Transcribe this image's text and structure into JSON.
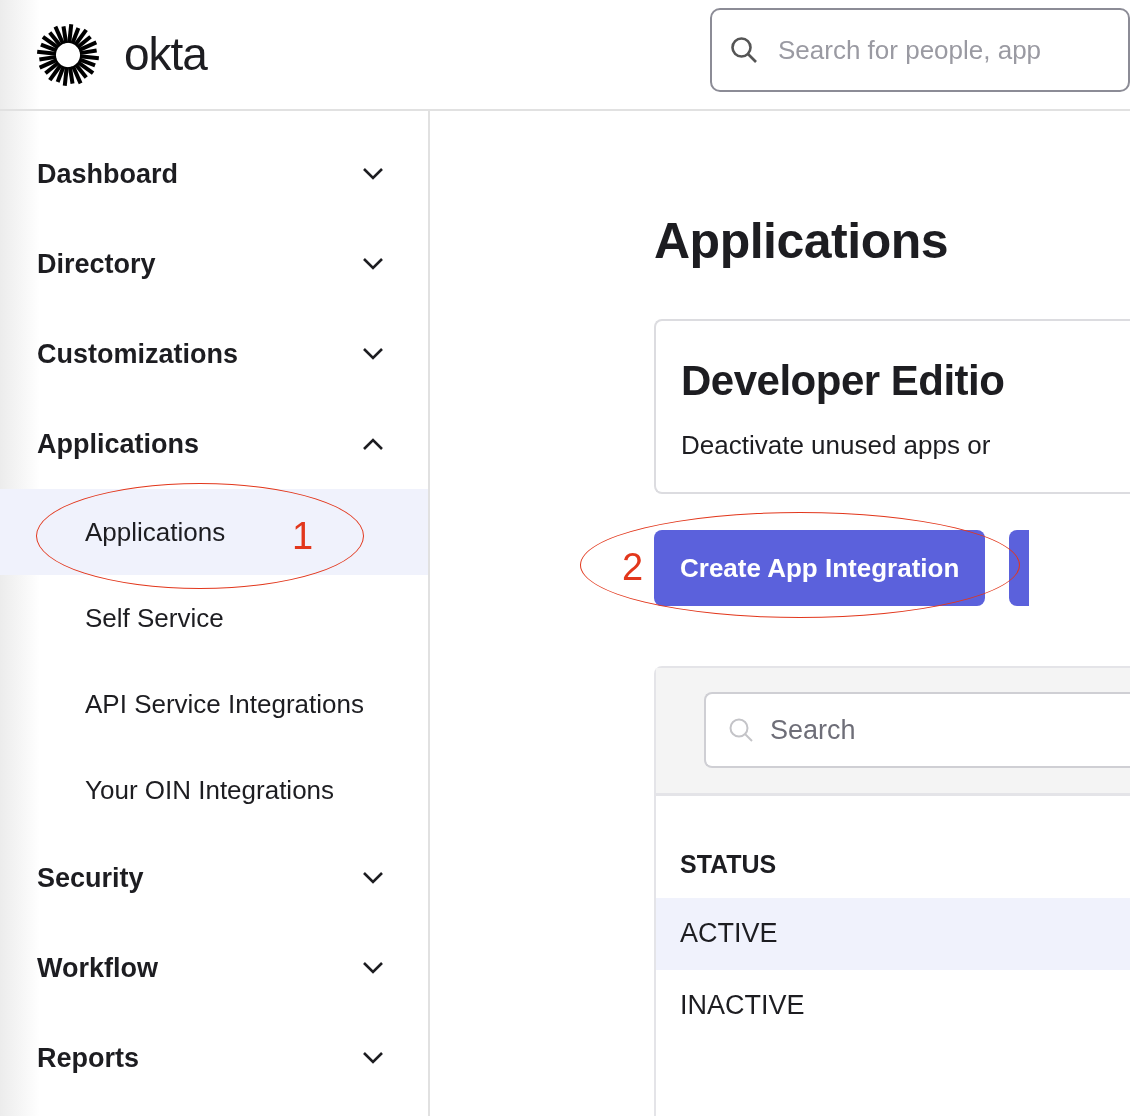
{
  "header": {
    "logo_text": "okta",
    "search": {
      "placeholder": "Search for people, app"
    }
  },
  "sidebar": {
    "items": [
      {
        "label": "Dashboard",
        "expanded": false
      },
      {
        "label": "Directory",
        "expanded": false
      },
      {
        "label": "Customizations",
        "expanded": false
      },
      {
        "label": "Applications",
        "expanded": true,
        "children": [
          {
            "label": "Applications",
            "selected": true
          },
          {
            "label": "Self Service",
            "selected": false
          },
          {
            "label": "API Service Integrations",
            "selected": false
          },
          {
            "label": "Your OIN Integrations",
            "selected": false
          }
        ]
      },
      {
        "label": "Security",
        "expanded": false
      },
      {
        "label": "Workflow",
        "expanded": false
      },
      {
        "label": "Reports",
        "expanded": false
      }
    ]
  },
  "main": {
    "title": "Applications",
    "notice": {
      "title": "Developer Editio",
      "text": "Deactivate unused apps or"
    },
    "buttons": [
      "Create App Integration"
    ],
    "filter_panel": {
      "search": {
        "placeholder": "Search"
      },
      "heading": "STATUS",
      "options": [
        {
          "label": "ACTIVE",
          "selected": true
        },
        {
          "label": "INACTIVE",
          "selected": false
        }
      ]
    }
  },
  "annotations": [
    {
      "label": "1"
    },
    {
      "label": "2"
    }
  ]
}
